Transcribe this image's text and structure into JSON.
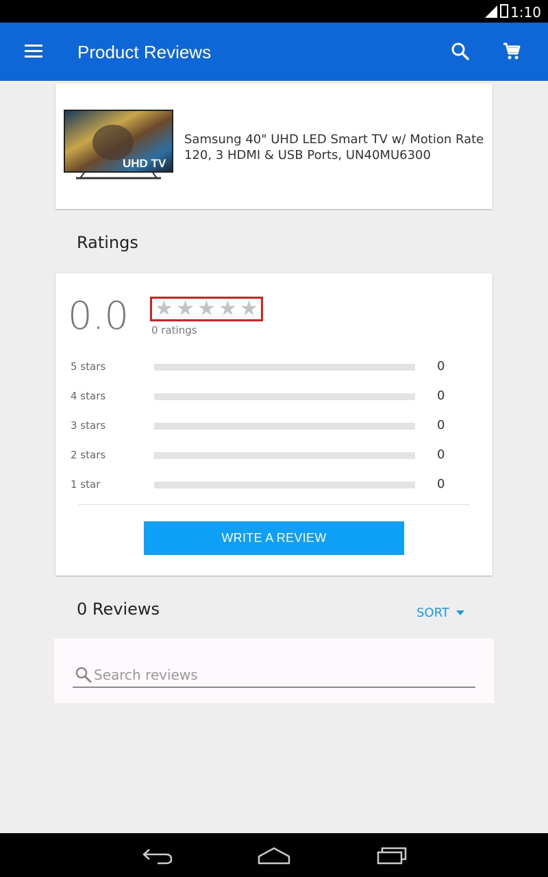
{
  "status_bar": {
    "time": "1:10",
    "network": "4G"
  },
  "app_bar": {
    "title": "Product Reviews",
    "menu_icon": "menu-icon",
    "search_icon": "search-icon",
    "cart_icon": "cart-icon"
  },
  "product": {
    "image_label": "UHD TV",
    "name": "Samsung 40\" UHD LED Smart TV w/ Motion Rate 120, 3 HDMI & USB Ports, UN40MU6300"
  },
  "ratings": {
    "section_title": "Ratings",
    "average": "0.0",
    "stars_filled": 0,
    "stars_total": 5,
    "count_label": "0 ratings",
    "breakdown": [
      {
        "label": "5 stars",
        "count": "0",
        "fraction": 0
      },
      {
        "label": "4 stars",
        "count": "0",
        "fraction": 0
      },
      {
        "label": "3 stars",
        "count": "0",
        "fraction": 0
      },
      {
        "label": "2 stars",
        "count": "0",
        "fraction": 0
      },
      {
        "label": "1 star",
        "count": "0",
        "fraction": 0
      }
    ],
    "write_review_label": "WRITE A REVIEW"
  },
  "reviews": {
    "title": "0 Reviews",
    "sort_label": "SORT",
    "search_placeholder": "Search reviews"
  },
  "colors": {
    "app_bar": "#0e67d6",
    "button": "#0ea0f6",
    "sort": "#1a9be6",
    "highlight": "#e21b1b",
    "star_empty": "#c4c4c4"
  }
}
